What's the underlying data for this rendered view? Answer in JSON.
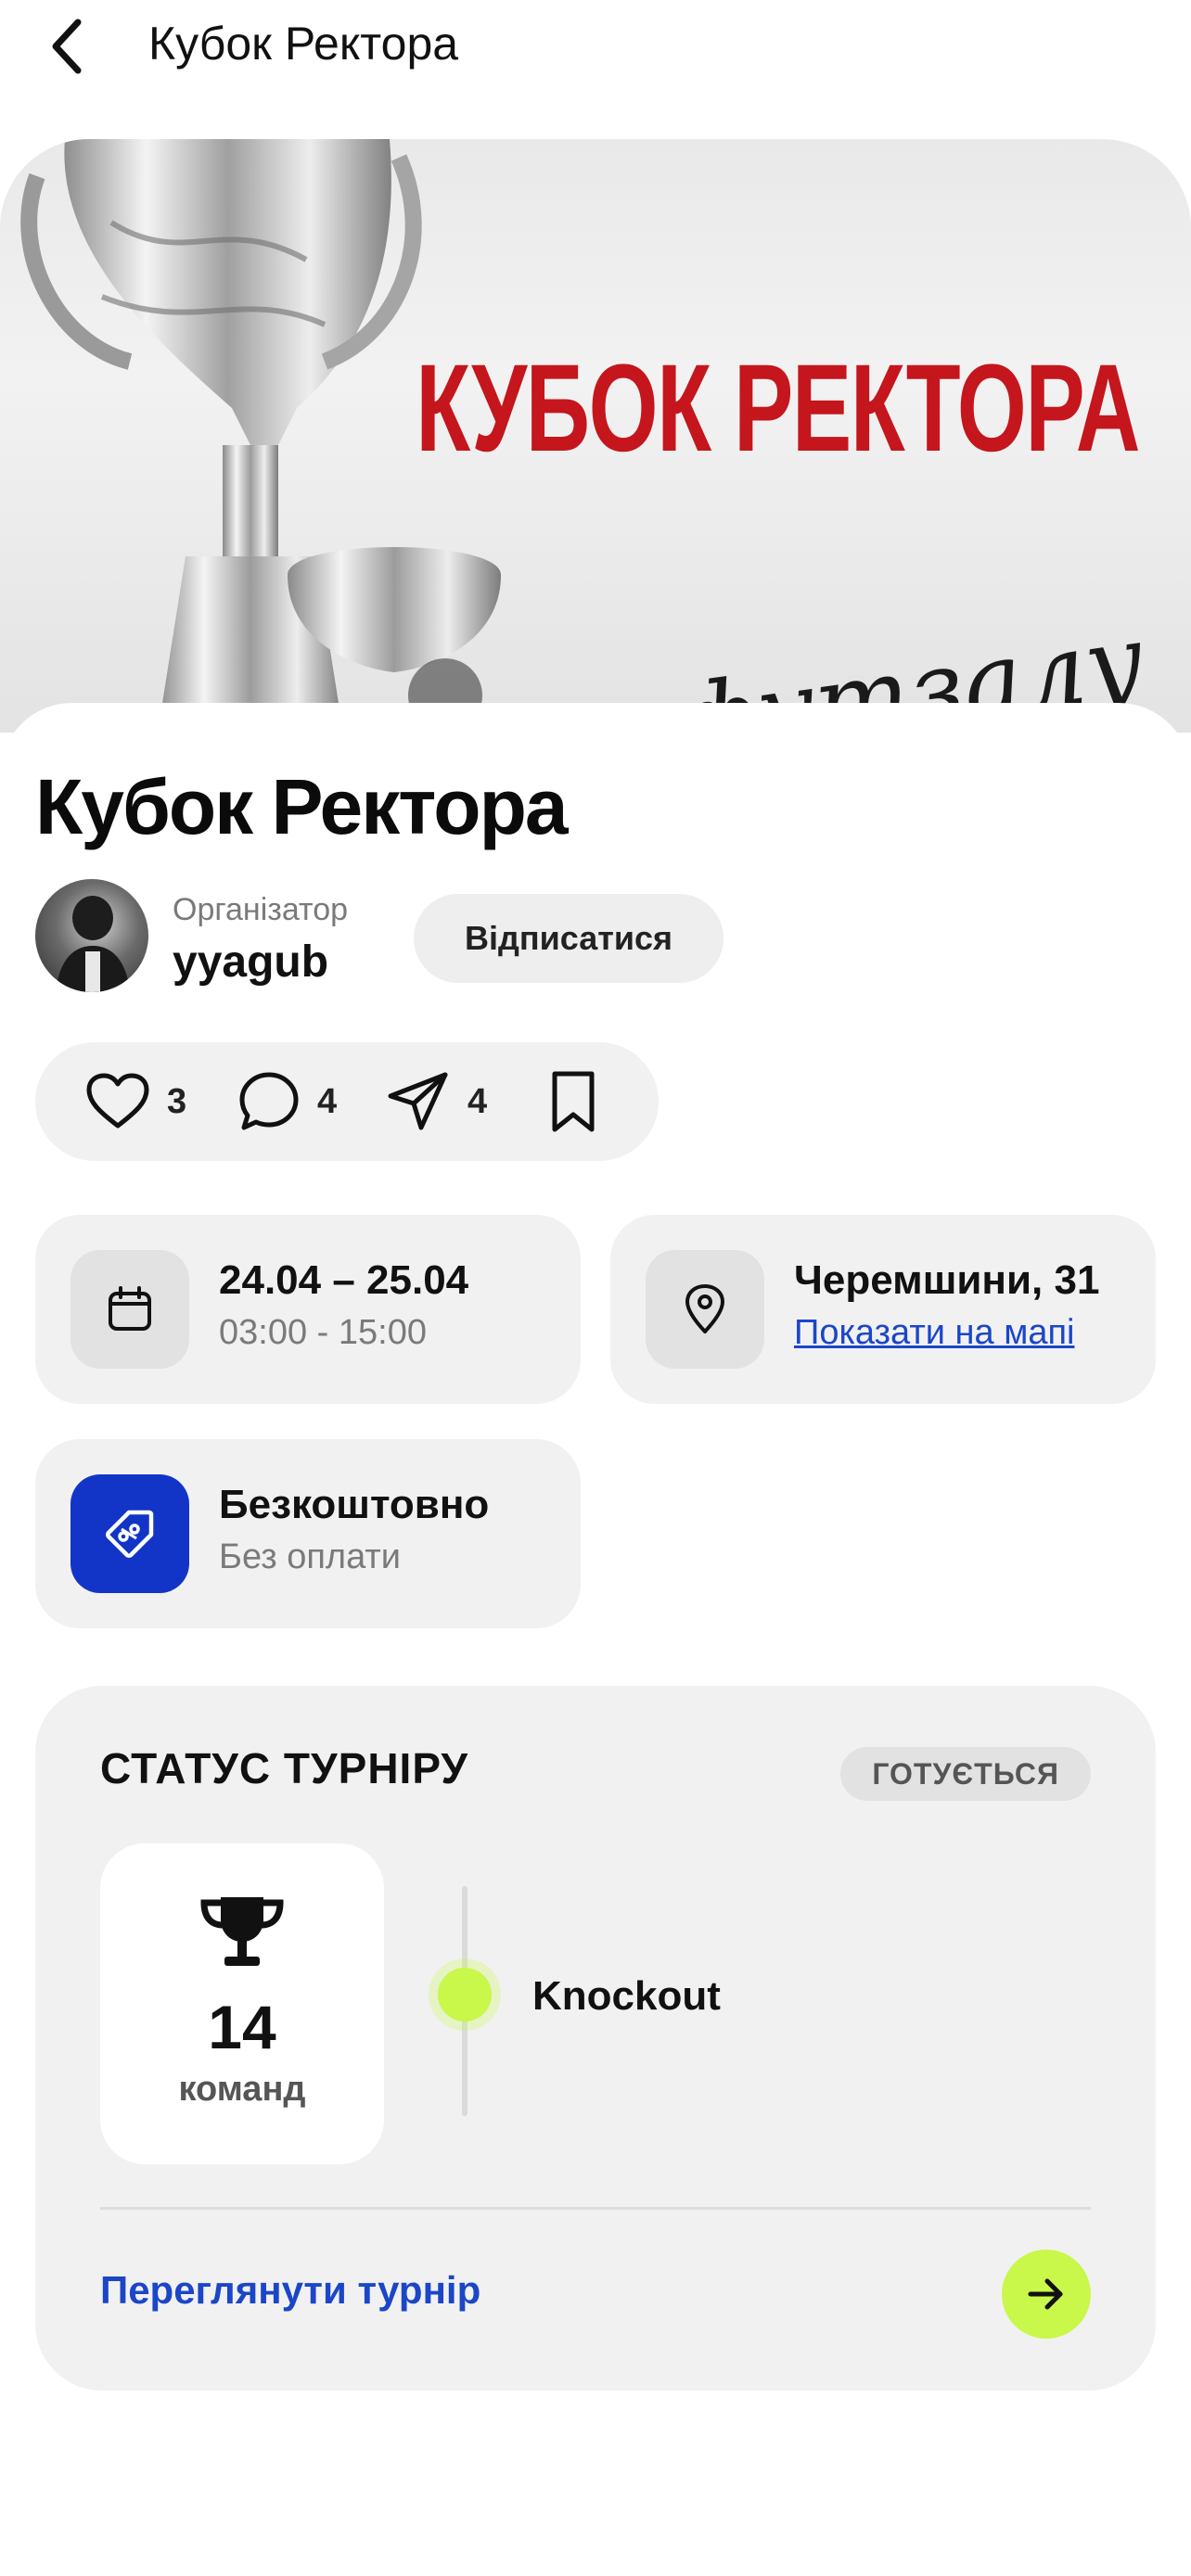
{
  "header": {
    "title": "Кубок Ректора"
  },
  "hero": {
    "title": "КУБОК РЕКТОРА",
    "subtitle": "з футзалу"
  },
  "event": {
    "title": "Кубок Ректора"
  },
  "organizer": {
    "label": "Організатор",
    "name": "yyagub",
    "unsubscribe_label": "Відписатися"
  },
  "actions": {
    "likes": "3",
    "comments": "4",
    "shares": "4"
  },
  "date": {
    "range": "24.04 – 25.04",
    "time": "03:00 - 15:00"
  },
  "location": {
    "address": "Черемшини, 31",
    "map_link": "Показати на мапі"
  },
  "price": {
    "title": "Безкоштовно",
    "subtitle": "Без оплати"
  },
  "status": {
    "title": "СТАТУС ТУРНІРУ",
    "badge": "ГОТУЄТЬСЯ",
    "teams_count": "14",
    "teams_label": "команд",
    "stage": "Knockout",
    "view_link": "Переглянути турнір"
  },
  "colors": {
    "accent_blue": "#1b46c8",
    "lime": "#c9f74a",
    "hero_red": "#c4161c",
    "tile_bg": "#f1f1f1",
    "price_icon_bg": "#1235c7"
  },
  "icons": [
    "back-icon",
    "heart-icon",
    "comment-icon",
    "send-icon",
    "bookmark-icon",
    "calendar-icon",
    "location-pin-icon",
    "price-tag-icon",
    "trophy-icon",
    "arrow-right-icon"
  ]
}
